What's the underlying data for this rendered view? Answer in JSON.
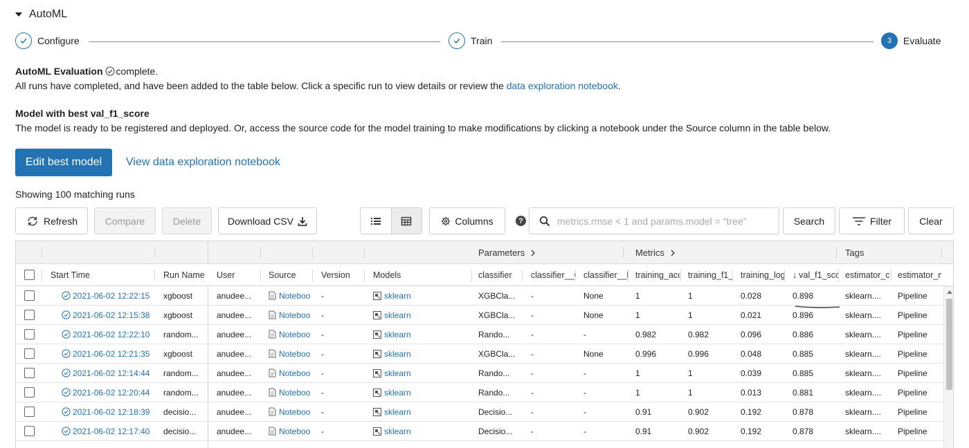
{
  "section": {
    "title": "AutoML"
  },
  "stepper": {
    "steps": [
      {
        "label": "Configure",
        "state": "done"
      },
      {
        "label": "Train",
        "state": "done"
      },
      {
        "label": "Evaluate",
        "state": "active",
        "number": "3"
      }
    ]
  },
  "evaluation": {
    "title": "AutoML Evaluation",
    "status": "complete.",
    "description": "All runs have completed, and have been added to the table below. Click a specific run to view details or review the",
    "link_text": "data exploration notebook",
    "link_suffix": "."
  },
  "best_model": {
    "title": "Model with best val_f1_score",
    "description": "The model is ready to be registered and deployed. Or, access the source code for the model training to make modifications by clicking a notebook under the Source column in the table below."
  },
  "actions": {
    "edit_best_model": "Edit best model",
    "view_notebook": "View data exploration notebook"
  },
  "runs_count_label": "Showing 100 matching runs",
  "toolbar": {
    "refresh": "Refresh",
    "compare": "Compare",
    "delete": "Delete",
    "download_csv": "Download CSV",
    "columns": "Columns",
    "help": "?",
    "search_placeholder": "metrics.rmse < 1 and params.model = \"tree\"",
    "search": "Search",
    "filter": "Filter",
    "clear": "Clear"
  },
  "table": {
    "groups": {
      "parameters": "Parameters",
      "metrics": "Metrics",
      "tags": "Tags"
    },
    "columns": [
      "Start Time",
      "Run Name",
      "User",
      "Source",
      "Version",
      "Models",
      "classifier",
      "classifier__C",
      "classifier__b",
      "training_acc",
      "training_f1_",
      "training_log",
      "val_f1_sco",
      "estimator_cl",
      "estimator_n"
    ],
    "sort_arrow": "↓",
    "rows": [
      [
        "2021-06-02 12:22:15",
        "xgboost",
        "anudee...",
        "Noteboo",
        "-",
        "sklearn",
        "XGBCla...",
        "-",
        "None",
        "1",
        "1",
        "0.028",
        "0.898",
        "sklearn....",
        "Pipeline"
      ],
      [
        "2021-06-02 12:15:38",
        "xgboost",
        "anudee...",
        "Noteboo",
        "-",
        "sklearn",
        "XGBCla...",
        "-",
        "None",
        "1",
        "1",
        "0.021",
        "0.896",
        "sklearn....",
        "Pipeline"
      ],
      [
        "2021-06-02 12:22:10",
        "random...",
        "anudee...",
        "Noteboo",
        "-",
        "sklearn",
        "Rando...",
        "-",
        "-",
        "0.982",
        "0.982",
        "0.096",
        "0.886",
        "sklearn....",
        "Pipeline"
      ],
      [
        "2021-06-02 12:21:35",
        "xgboost",
        "anudee...",
        "Noteboo",
        "-",
        "sklearn",
        "XGBCla...",
        "-",
        "None",
        "0.996",
        "0.996",
        "0.048",
        "0.885",
        "sklearn....",
        "Pipeline"
      ],
      [
        "2021-06-02 12:14:44",
        "random...",
        "anudee...",
        "Noteboo",
        "-",
        "sklearn",
        "Rando...",
        "-",
        "-",
        "1",
        "1",
        "0.039",
        "0.885",
        "sklearn....",
        "Pipeline"
      ],
      [
        "2021-06-02 12:20:44",
        "random...",
        "anudee...",
        "Noteboo",
        "-",
        "sklearn",
        "Rando...",
        "-",
        "-",
        "1",
        "1",
        "0.013",
        "0.881",
        "sklearn....",
        "Pipeline"
      ],
      [
        "2021-06-02 12:18:39",
        "decisio...",
        "anudee...",
        "Noteboo",
        "-",
        "sklearn",
        "Decisio...",
        "-",
        "-",
        "0.91",
        "0.902",
        "0.192",
        "0.878",
        "sklearn....",
        "Pipeline"
      ],
      [
        "2021-06-02 12:17:40",
        "decisio...",
        "anudee...",
        "Noteboo",
        "-",
        "sklearn",
        "Decisio...",
        "-",
        "-",
        "0.91",
        "0.902",
        "0.192",
        "0.878",
        "sklearn....",
        "Pipeline"
      ]
    ]
  },
  "colors": {
    "accent": "#2272b4"
  }
}
